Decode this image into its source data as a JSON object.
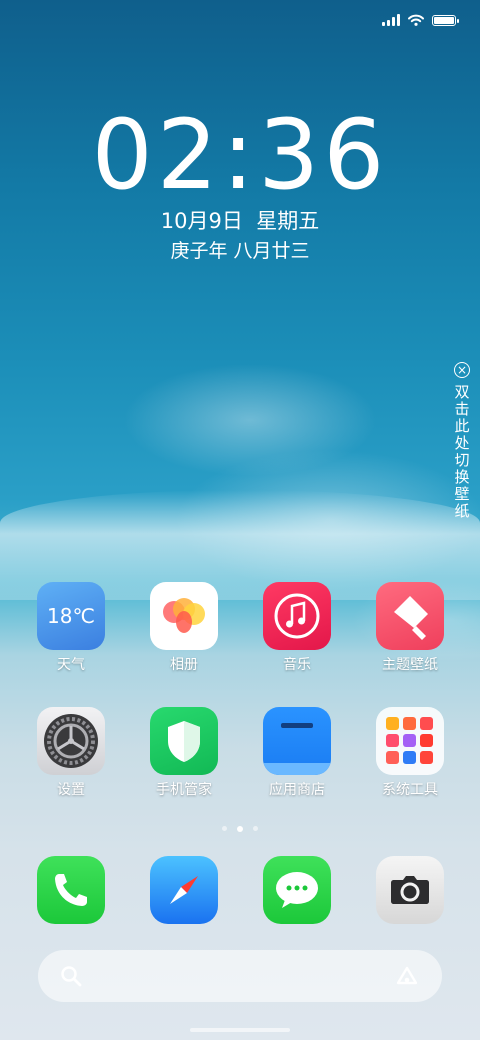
{
  "status": {
    "signal": "signal-icon",
    "wifi": "wifi-icon",
    "battery": "battery-icon",
    "battery_level": 1.0
  },
  "lockscreen": {
    "time_hour": "02",
    "time_sep": ":",
    "time_min": "36",
    "date": "10月9日  星期五",
    "lunar": "庚子年 八月廿三",
    "wallpaper_hint": "双击此处切换壁纸"
  },
  "apps": [
    {
      "label": "天气",
      "icon": "weather-icon",
      "temp": "18℃"
    },
    {
      "label": "相册",
      "icon": "photos-icon"
    },
    {
      "label": "音乐",
      "icon": "music-note-icon"
    },
    {
      "label": "主题壁纸",
      "icon": "theme-brush-icon"
    },
    {
      "label": "设置",
      "icon": "gear-icon"
    },
    {
      "label": "手机管家",
      "icon": "shield-icon"
    },
    {
      "label": "应用商店",
      "icon": "app-store-icon"
    },
    {
      "label": "系统工具",
      "icon": "tools-folder-icon"
    }
  ],
  "page_indicator": {
    "pages": 3,
    "current": 2
  },
  "dock": [
    {
      "icon": "phone-icon"
    },
    {
      "icon": "compass-icon"
    },
    {
      "icon": "message-bubble-icon"
    },
    {
      "icon": "camera-icon"
    }
  ],
  "search_bar": {
    "left_icon": "search-icon",
    "right_icon": "assistant-icon"
  },
  "colors": {
    "music": "#ff2d55",
    "security": "#1fc862",
    "store": "#1a7cf2",
    "theme": "#f5506a"
  }
}
